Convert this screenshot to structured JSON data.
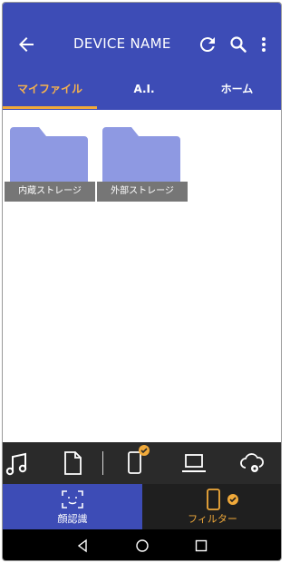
{
  "header": {
    "title": "DEVICE NAME",
    "icons": [
      "back-arrow-icon",
      "refresh-icon",
      "search-icon",
      "more-vertical-icon"
    ]
  },
  "tabs": [
    {
      "label": "マイファイル",
      "active": true
    },
    {
      "label": "A.I.",
      "active": false
    },
    {
      "label": "ホーム",
      "active": false
    }
  ],
  "folders": [
    {
      "label": "内蔵ストレージ",
      "icon": "folder-icon"
    },
    {
      "label": "外部ストレージ",
      "icon": "folder-icon"
    }
  ],
  "bottom_icons": [
    "music-icon",
    "document-icon",
    "phone-icon",
    "laptop-icon",
    "cloud-settings-icon"
  ],
  "modes": {
    "face_label": "顔認識",
    "filter_label": "フィルター"
  },
  "colors": {
    "primary": "#3d4cb6",
    "accent": "#f0a93a",
    "folder": "#8e99e2",
    "folder_label_bg": "#767676",
    "dark_bar": "#2a2a2a"
  }
}
